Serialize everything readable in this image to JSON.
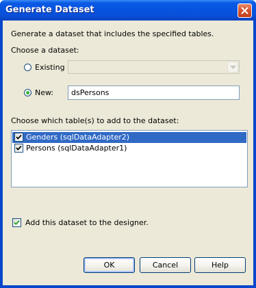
{
  "window": {
    "title": "Generate Dataset"
  },
  "description": "Generate a dataset that includes the specified tables.",
  "choose_dataset": {
    "heading": "Choose a dataset:",
    "existing_label": "Existing",
    "existing_value": "",
    "new_label": "New:",
    "new_value": "dsPersons",
    "selected_option": "new"
  },
  "tables": {
    "heading": "Choose which table(s) to add to the dataset:",
    "items": [
      {
        "label": "Genders (sqlDataAdapter2)",
        "checked": true,
        "selected": true
      },
      {
        "label": "Persons (sqlDataAdapter1)",
        "checked": true,
        "selected": false
      }
    ]
  },
  "add_to_designer": {
    "label": "Add this dataset to the designer.",
    "checked": true
  },
  "buttons": {
    "ok": "OK",
    "cancel": "Cancel",
    "help": "Help"
  },
  "colors": {
    "title_bar": "#0a55e0",
    "client_background": "#ece9d8",
    "selection": "#316ac5",
    "close_button": "#d9542e",
    "field_border": "#7f9db9"
  },
  "icons": {
    "close": "close-icon",
    "dropdown": "chevron-down-icon",
    "check": "checkmark-icon"
  }
}
